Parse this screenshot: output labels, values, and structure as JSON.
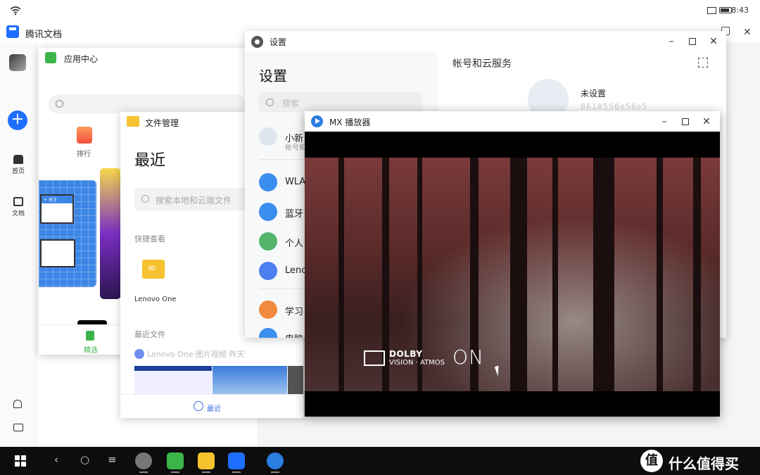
{
  "status_bar": {
    "time": "8:43"
  },
  "tencent_docs": {
    "title": "腾讯文档",
    "nav": [
      {
        "label": "首页",
        "icon": "home-icon"
      },
      {
        "label": "文档",
        "icon": "document-icon"
      }
    ]
  },
  "app_center": {
    "title": "应用中心",
    "rank_label": "排行",
    "bottom_tab": "精选",
    "banner_text": "+ 关注"
  },
  "file_manager": {
    "title": "文件管理",
    "heading": "最近",
    "search_placeholder": "搜索本地和云端文件",
    "quick_view_label": "快捷查看",
    "folder_label": "Lenovo One",
    "recent_files_label": "最近文件",
    "recent_source": "Lenovo One·图片视频 昨天",
    "bottom_tab": "最近"
  },
  "settings": {
    "title": "设置",
    "heading": "设置",
    "search_placeholder": "搜索",
    "account_name": "小新",
    "account_sub": "帐号和",
    "items": [
      {
        "label": "WLA",
        "color": "#3b8df0",
        "icon": "wifi-icon"
      },
      {
        "label": "蓝牙",
        "color": "#3b8df0",
        "icon": "bluetooth-icon"
      },
      {
        "label": "个人",
        "color": "#53b46a",
        "icon": "link-icon"
      },
      {
        "label": "Leno",
        "color": "#4c7ff0",
        "icon": "lenovo-one-icon"
      },
      {
        "label": "学习",
        "color": "#f08a3c",
        "icon": "graduation-icon"
      },
      {
        "label": "电脑",
        "color": "#3b8df0",
        "icon": "computer-icon"
      }
    ],
    "right_title": "帐号和云服务",
    "unset_label": "未设置",
    "masked_account": "8618556e56e5"
  },
  "mx_player": {
    "title": "MX 播放器",
    "dolby_line1": "DOLBY",
    "dolby_line2": "VISION · ATMOS",
    "dolby_on": "ON"
  },
  "watermark": {
    "text": "什么值得买",
    "logo_char": "值"
  },
  "taskbar_apps": [
    {
      "name": "settings",
      "color": "#777777"
    },
    {
      "name": "app-center",
      "color": "#3bb54a"
    },
    {
      "name": "file-manager",
      "color": "#f6c22e"
    },
    {
      "name": "tencent-docs",
      "color": "#1e6fff"
    },
    {
      "name": "mx-player",
      "color": "#2a7de1"
    }
  ]
}
